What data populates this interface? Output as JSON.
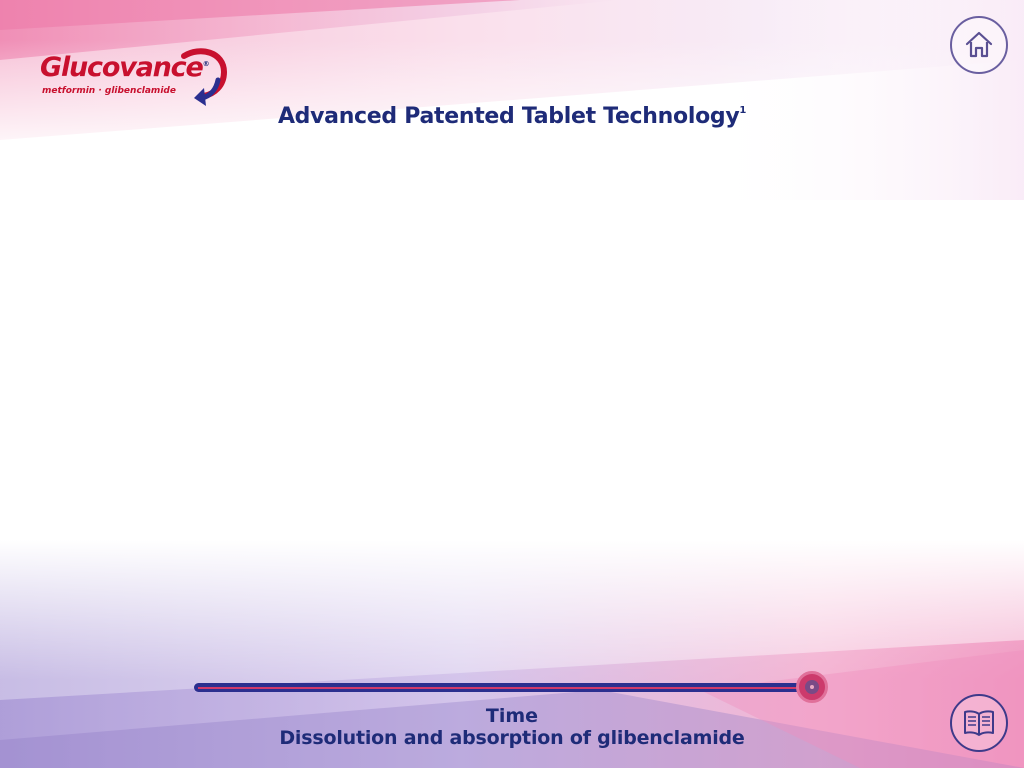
{
  "brand": {
    "name": "Glucovance",
    "registered": "®",
    "subtitle": "metformin · glibenclamide"
  },
  "page": {
    "title": "Advanced Patented Tablet Technology",
    "title_superscript": "1"
  },
  "timeline": {
    "label": "Time",
    "caption": "Dissolution and absorption of glibenclamide",
    "progress": 1.0
  },
  "buttons": {
    "home_icon": "home-icon",
    "references_icon": "book-icon"
  },
  "colors": {
    "brand_red": "#c8102e",
    "navy": "#1e2b78",
    "accent_pink": "#cc3a6c",
    "accent_purple": "#6a5fa0"
  }
}
